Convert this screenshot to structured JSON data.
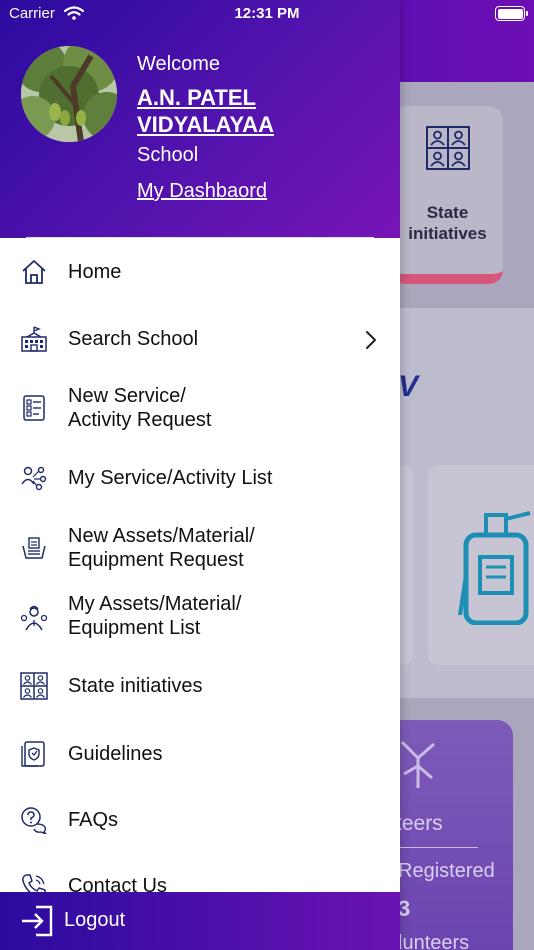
{
  "status_bar": {
    "carrier": "Carrier",
    "time": "12:31 PM"
  },
  "drawer": {
    "welcome": "Welcome",
    "school_name": "A.N. PATEL VIDYALAYAA",
    "school_type": "School",
    "dashboard_link": "My Dashbaord",
    "menu": [
      {
        "label": "Home",
        "icon": "home-icon"
      },
      {
        "label": "Search School",
        "icon": "school-building-icon",
        "has_chevron": true
      },
      {
        "label": "New Service/\nActivity Request",
        "icon": "request-form-icon"
      },
      {
        "label": "My Service/Activity List",
        "icon": "people-network-icon"
      },
      {
        "label": "New Assets/Material/\nEquipment Request",
        "icon": "assets-request-icon"
      },
      {
        "label": "My Assets/Material/\nEquipment List",
        "icon": "person-tools-icon"
      },
      {
        "label": "State initiatives",
        "icon": "state-grid-icon"
      },
      {
        "label": "Guidelines",
        "icon": "guidelines-icon"
      },
      {
        "label": "FAQs",
        "icon": "faq-bubble-icon"
      },
      {
        "label": "Contact Us",
        "icon": "phone-icon"
      }
    ],
    "logout": "Logout"
  },
  "background": {
    "state_card_label": "State initiatives",
    "section_letter": "V",
    "volunteers_title": "teers",
    "volunteers_registered": "Registered",
    "volunteers_count": "3",
    "volunteers_footer": "lunteers"
  },
  "colors": {
    "brand_start": "#2a0b9e",
    "brand_end": "#7814b8",
    "icon_navy": "#1f2a6b",
    "accent_pink": "#d6577a"
  }
}
